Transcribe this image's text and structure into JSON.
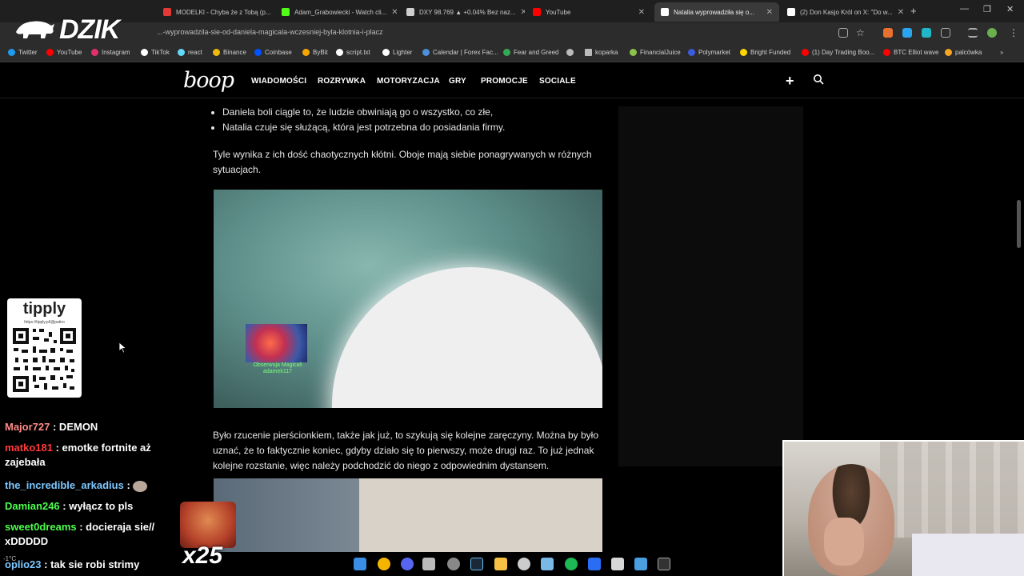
{
  "tabs": [
    {
      "label": "MODELKI - Chyba że z Tobą (p...",
      "favicon_color": "#e53935"
    },
    {
      "label": "Adam_Grabowiecki - Watch cli...",
      "favicon_color": "#53fc18"
    },
    {
      "label": "DXY 98.769 ▲ +0.04% Bez naz...",
      "favicon_color": "#cfcfcf"
    },
    {
      "label": "YouTube",
      "favicon_color": "#ff0000"
    },
    {
      "label": "Natalia wyprowadziła się o...",
      "favicon_color": "#ffffff",
      "active": true
    },
    {
      "label": "(2) Don Kasjo Król on X: \"Do w...",
      "favicon_color": "#ffffff"
    }
  ],
  "address": {
    "url": "...-wyprowadzila-sie-od-daniela-magicala-wczesniej-byla-klotnia-i-placz"
  },
  "bookmarks": [
    {
      "label": "Twitter",
      "color": "#1d9bf0"
    },
    {
      "label": "YouTube",
      "color": "#ff0000"
    },
    {
      "label": "Instagram",
      "color": "#e1306c"
    },
    {
      "label": "TikTok",
      "color": "#ffffff"
    },
    {
      "label": "react",
      "color": "#61dafb"
    },
    {
      "label": "Binance",
      "color": "#f0b90b"
    },
    {
      "label": "Coinbase",
      "color": "#0052ff"
    },
    {
      "label": "ByBit",
      "color": "#f7a600"
    },
    {
      "label": "script.txt",
      "color": "#ffffff"
    },
    {
      "label": "Lighter",
      "color": "#ffffff"
    },
    {
      "label": "Calendar | Forex Fac...",
      "color": "#4a90d9"
    },
    {
      "label": "Fear and Greed",
      "color": "#34a853"
    },
    {
      "label": "",
      "color": "#bbbbbb"
    },
    {
      "label": "koparka",
      "color": "#bbbbbb"
    },
    {
      "label": "FinancialJuice",
      "color": "#8bc34a"
    },
    {
      "label": "Polymarket",
      "color": "#3b5bdb"
    },
    {
      "label": "Bright Funded",
      "color": "#ffd600"
    },
    {
      "label": "(1) Day Trading Boo...",
      "color": "#ff0000"
    },
    {
      "label": "BTC Elliot wave",
      "color": "#ff0000"
    },
    {
      "label": "palcówka",
      "color": "#f5a623"
    }
  ],
  "site": {
    "logo": "boop",
    "nav": [
      "WIADOMOŚCI",
      "ROZRYWKA",
      "MOTORYZACJA",
      "GRY",
      "PROMOCJE",
      "SOCIALE"
    ]
  },
  "article": {
    "bullets": [
      "Daniela boli ciągle to, że ludzie obwiniają go o wszystko, co złe,",
      "Natalia czuje się służącą, która jest potrzebna do posiadania firmy."
    ],
    "para1": "Tyle wynika z ich dość chaotycznych kłótni. Oboje mają siebie ponagrywanych w różnych sytuacjach.",
    "para2": "Było rzucenie pierścionkiem, także jak już, to szykują się kolejne zaręczyny. Można by było uznać, że to faktycznie koniec, gdyby działo się to pierwszy, może drugi raz. To już jednak kolejne rozstanie, więc należy podchodzić do niego z odpowiednim dystansem.",
    "image_caption_line1": "Obserwuja Magicali",
    "image_caption_line2": "adamek117"
  },
  "overlay": {
    "brand": "DZIK",
    "tipply_title": "tipply",
    "tipply_url": "https://tipply.pl/@patiro",
    "multiplier": "x25",
    "weather": "-1°C",
    "chat": [
      {
        "user": "Major727",
        "text": " : DEMON",
        "color": "#ff6b6b"
      },
      {
        "user": "matko181",
        "text": " : emotke fortnite aż zajebała",
        "color": "#ff3b3b"
      },
      {
        "user": "the_incredible_arkadius",
        "text": " :",
        "color": "#7ec8ff"
      },
      {
        "user": "Damian246",
        "text": " : wyłącz to pls",
        "color": "#4cff4c"
      },
      {
        "user": "sweet0dreams",
        "text": " : docieraja sie// xDDDDD",
        "color": "#4cff4c"
      },
      {
        "user": "oplio23",
        "text": " : tak sie robi strimy",
        "color": "#7ec8ff"
      }
    ]
  },
  "colors": {
    "page_bg": "#000000",
    "text": "#e6e6e6",
    "chrome": "#2c2c2c"
  }
}
